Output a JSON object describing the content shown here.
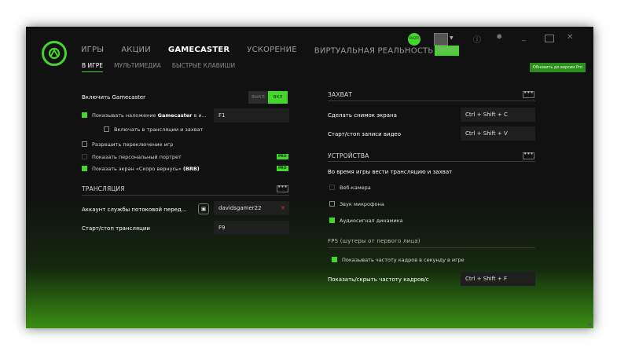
{
  "app": {
    "logo_icon": "razer-snake-logo-icon",
    "accent": "#44d62c",
    "user_badge": "RAZR",
    "upgrade_button": "Обновить до версии Pro"
  },
  "topnav": [
    {
      "label": "ИГРЫ"
    },
    {
      "label": "АКЦИИ"
    },
    {
      "label": "GAMECASTER"
    },
    {
      "label": "УСКОРЕНИЕ"
    },
    {
      "label": "ВИРТУАЛЬНАЯ РЕАЛЬНОСТЬ"
    }
  ],
  "beta_badge": "BETA",
  "subnav": [
    {
      "label": "В ИГРЕ"
    },
    {
      "label": "МУЛЬТИМЕДИА"
    },
    {
      "label": "БЫСТРЫЕ КЛАВИШИ"
    }
  ],
  "left": {
    "enable_label": "Включить Gamecaster",
    "toggle_off": "ВЫКЛ",
    "toggle_on": "ВКЛ",
    "overlay_label_pre": "Показывать наложение ",
    "overlay_label_bold": "Gamecaster",
    "overlay_label_post": " в и...",
    "overlay_key": "F1",
    "include_stream_label": "Включать в трансляции и захват",
    "allow_switch_label": "Разрешить переключение игр",
    "personal_portrait_label": "Показать персональный портрет",
    "brb_label_pre": "Показать экран «Скоро вернусь» ",
    "brb_label_bold": "(BRB)",
    "pro": "PRO",
    "broadcast_section": "ТРАНСЛЯЦИЯ",
    "account_label": "Аккаунт службы потоковой перед...",
    "account_value": "davidsgamer22",
    "start_stop_label": "Старт/стоп трансляции",
    "start_stop_key": "F9"
  },
  "right": {
    "capture_section": "ЗАХВАТ",
    "screenshot_label": "Сделать снимок экрана",
    "screenshot_key": "Ctrl + Shift + C",
    "video_label": "Старт/стоп записи видео",
    "video_key": "Ctrl + Shift + V",
    "devices_section": "УСТРОЙСТВА",
    "devices_desc": "Во время игры вести трансляцию и захват",
    "webcam_label": "Веб-камера",
    "mic_label": "Звук микрофона",
    "speaker_label": "Аудиосигнал динамика",
    "fps_section": "FPS (шутеры от первого лица)",
    "fps_show_label": "Показывать частоту кадров в секунду в игре",
    "fps_toggle_label": "Показать/скрыть частоту кадров/с",
    "fps_toggle_key": "Ctrl + Shift + F"
  },
  "more_dots": "•••",
  "window_controls": [
    "info-icon",
    "settings-icon",
    "minimize-icon",
    "maximize-icon",
    "close-icon"
  ]
}
